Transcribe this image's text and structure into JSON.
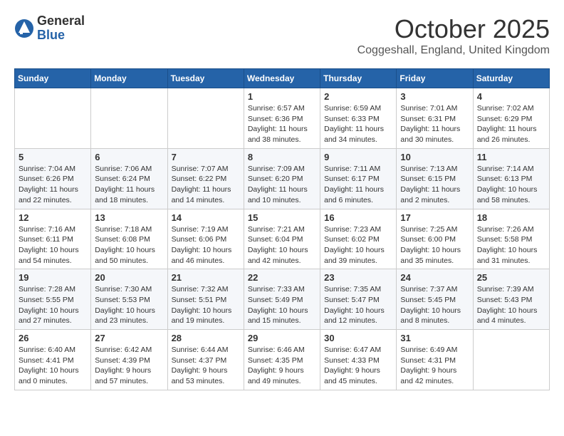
{
  "header": {
    "logo_general": "General",
    "logo_blue": "Blue",
    "month": "October 2025",
    "location": "Coggeshall, England, United Kingdom"
  },
  "weekdays": [
    "Sunday",
    "Monday",
    "Tuesday",
    "Wednesday",
    "Thursday",
    "Friday",
    "Saturday"
  ],
  "weeks": [
    [
      {
        "day": "",
        "sunrise": "",
        "sunset": "",
        "daylight": "",
        "empty": true
      },
      {
        "day": "",
        "sunrise": "",
        "sunset": "",
        "daylight": "",
        "empty": true
      },
      {
        "day": "",
        "sunrise": "",
        "sunset": "",
        "daylight": "",
        "empty": true
      },
      {
        "day": "1",
        "sunrise": "Sunrise: 6:57 AM",
        "sunset": "Sunset: 6:36 PM",
        "daylight": "Daylight: 11 hours and 38 minutes."
      },
      {
        "day": "2",
        "sunrise": "Sunrise: 6:59 AM",
        "sunset": "Sunset: 6:33 PM",
        "daylight": "Daylight: 11 hours and 34 minutes."
      },
      {
        "day": "3",
        "sunrise": "Sunrise: 7:01 AM",
        "sunset": "Sunset: 6:31 PM",
        "daylight": "Daylight: 11 hours and 30 minutes."
      },
      {
        "day": "4",
        "sunrise": "Sunrise: 7:02 AM",
        "sunset": "Sunset: 6:29 PM",
        "daylight": "Daylight: 11 hours and 26 minutes."
      }
    ],
    [
      {
        "day": "5",
        "sunrise": "Sunrise: 7:04 AM",
        "sunset": "Sunset: 6:26 PM",
        "daylight": "Daylight: 11 hours and 22 minutes."
      },
      {
        "day": "6",
        "sunrise": "Sunrise: 7:06 AM",
        "sunset": "Sunset: 6:24 PM",
        "daylight": "Daylight: 11 hours and 18 minutes."
      },
      {
        "day": "7",
        "sunrise": "Sunrise: 7:07 AM",
        "sunset": "Sunset: 6:22 PM",
        "daylight": "Daylight: 11 hours and 14 minutes."
      },
      {
        "day": "8",
        "sunrise": "Sunrise: 7:09 AM",
        "sunset": "Sunset: 6:20 PM",
        "daylight": "Daylight: 11 hours and 10 minutes."
      },
      {
        "day": "9",
        "sunrise": "Sunrise: 7:11 AM",
        "sunset": "Sunset: 6:17 PM",
        "daylight": "Daylight: 11 hours and 6 minutes."
      },
      {
        "day": "10",
        "sunrise": "Sunrise: 7:13 AM",
        "sunset": "Sunset: 6:15 PM",
        "daylight": "Daylight: 11 hours and 2 minutes."
      },
      {
        "day": "11",
        "sunrise": "Sunrise: 7:14 AM",
        "sunset": "Sunset: 6:13 PM",
        "daylight": "Daylight: 10 hours and 58 minutes."
      }
    ],
    [
      {
        "day": "12",
        "sunrise": "Sunrise: 7:16 AM",
        "sunset": "Sunset: 6:11 PM",
        "daylight": "Daylight: 10 hours and 54 minutes."
      },
      {
        "day": "13",
        "sunrise": "Sunrise: 7:18 AM",
        "sunset": "Sunset: 6:08 PM",
        "daylight": "Daylight: 10 hours and 50 minutes."
      },
      {
        "day": "14",
        "sunrise": "Sunrise: 7:19 AM",
        "sunset": "Sunset: 6:06 PM",
        "daylight": "Daylight: 10 hours and 46 minutes."
      },
      {
        "day": "15",
        "sunrise": "Sunrise: 7:21 AM",
        "sunset": "Sunset: 6:04 PM",
        "daylight": "Daylight: 10 hours and 42 minutes."
      },
      {
        "day": "16",
        "sunrise": "Sunrise: 7:23 AM",
        "sunset": "Sunset: 6:02 PM",
        "daylight": "Daylight: 10 hours and 39 minutes."
      },
      {
        "day": "17",
        "sunrise": "Sunrise: 7:25 AM",
        "sunset": "Sunset: 6:00 PM",
        "daylight": "Daylight: 10 hours and 35 minutes."
      },
      {
        "day": "18",
        "sunrise": "Sunrise: 7:26 AM",
        "sunset": "Sunset: 5:58 PM",
        "daylight": "Daylight: 10 hours and 31 minutes."
      }
    ],
    [
      {
        "day": "19",
        "sunrise": "Sunrise: 7:28 AM",
        "sunset": "Sunset: 5:55 PM",
        "daylight": "Daylight: 10 hours and 27 minutes."
      },
      {
        "day": "20",
        "sunrise": "Sunrise: 7:30 AM",
        "sunset": "Sunset: 5:53 PM",
        "daylight": "Daylight: 10 hours and 23 minutes."
      },
      {
        "day": "21",
        "sunrise": "Sunrise: 7:32 AM",
        "sunset": "Sunset: 5:51 PM",
        "daylight": "Daylight: 10 hours and 19 minutes."
      },
      {
        "day": "22",
        "sunrise": "Sunrise: 7:33 AM",
        "sunset": "Sunset: 5:49 PM",
        "daylight": "Daylight: 10 hours and 15 minutes."
      },
      {
        "day": "23",
        "sunrise": "Sunrise: 7:35 AM",
        "sunset": "Sunset: 5:47 PM",
        "daylight": "Daylight: 10 hours and 12 minutes."
      },
      {
        "day": "24",
        "sunrise": "Sunrise: 7:37 AM",
        "sunset": "Sunset: 5:45 PM",
        "daylight": "Daylight: 10 hours and 8 minutes."
      },
      {
        "day": "25",
        "sunrise": "Sunrise: 7:39 AM",
        "sunset": "Sunset: 5:43 PM",
        "daylight": "Daylight: 10 hours and 4 minutes."
      }
    ],
    [
      {
        "day": "26",
        "sunrise": "Sunrise: 6:40 AM",
        "sunset": "Sunset: 4:41 PM",
        "daylight": "Daylight: 10 hours and 0 minutes."
      },
      {
        "day": "27",
        "sunrise": "Sunrise: 6:42 AM",
        "sunset": "Sunset: 4:39 PM",
        "daylight": "Daylight: 9 hours and 57 minutes."
      },
      {
        "day": "28",
        "sunrise": "Sunrise: 6:44 AM",
        "sunset": "Sunset: 4:37 PM",
        "daylight": "Daylight: 9 hours and 53 minutes."
      },
      {
        "day": "29",
        "sunrise": "Sunrise: 6:46 AM",
        "sunset": "Sunset: 4:35 PM",
        "daylight": "Daylight: 9 hours and 49 minutes."
      },
      {
        "day": "30",
        "sunrise": "Sunrise: 6:47 AM",
        "sunset": "Sunset: 4:33 PM",
        "daylight": "Daylight: 9 hours and 45 minutes."
      },
      {
        "day": "31",
        "sunrise": "Sunrise: 6:49 AM",
        "sunset": "Sunset: 4:31 PM",
        "daylight": "Daylight: 9 hours and 42 minutes."
      },
      {
        "day": "",
        "sunrise": "",
        "sunset": "",
        "daylight": "",
        "empty": true
      }
    ]
  ]
}
